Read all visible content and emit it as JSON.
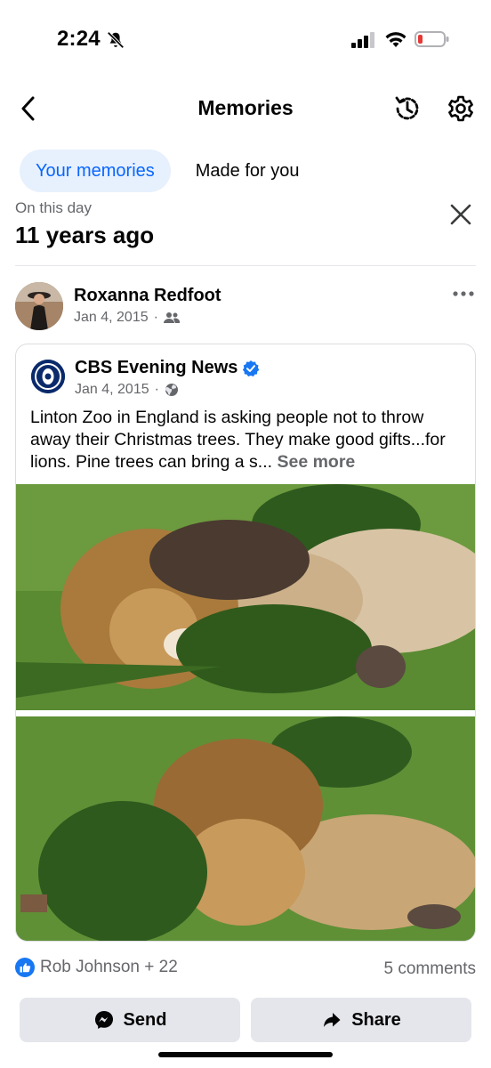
{
  "status_bar": {
    "time": "2:24",
    "battery_color": "#e53935"
  },
  "header": {
    "title": "Memories"
  },
  "tabs": [
    {
      "label": "Your memories",
      "active": true
    },
    {
      "label": "Made for you",
      "active": false
    }
  ],
  "memory": {
    "label": "On this day",
    "years_ago": "11 years ago"
  },
  "post": {
    "author": "Roxanna Redfoot",
    "date": "Jan 4, 2015",
    "audience_icon": "friends-icon",
    "shared": {
      "page_name": "CBS Evening News",
      "date": "Jan 4, 2015",
      "audience_icon": "globe-icon",
      "text": "Linton Zoo in England is asking people not to throw away their Christmas trees. They make good gifts...for lions. Pine trees can bring a s...",
      "see_more": "See more"
    },
    "reactions": "Rob Johnson + 22",
    "comments": "5 comments"
  },
  "actions": {
    "send": "Send",
    "share": "Share"
  },
  "colors": {
    "accent": "#0866ff",
    "tab_bg": "#e7f0fd",
    "button_bg": "#e4e6eb",
    "muted": "#65676b"
  }
}
